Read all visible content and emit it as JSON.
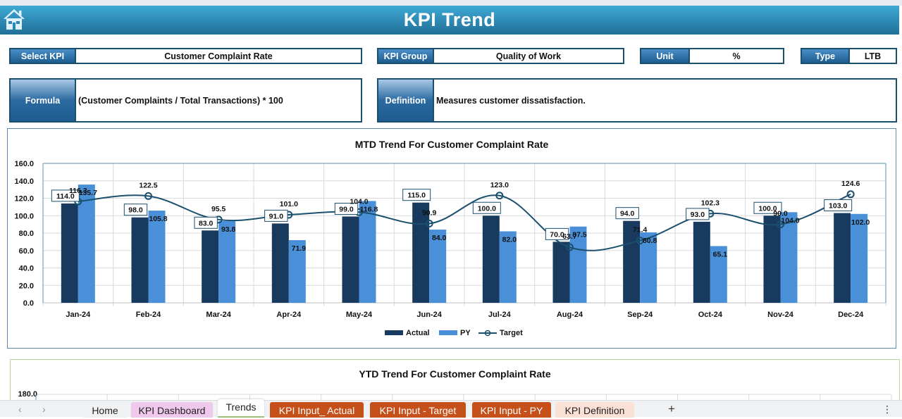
{
  "header": {
    "title": "KPI Trend",
    "home_icon": "home-icon"
  },
  "fields": {
    "select_kpi": {
      "label": "Select KPI",
      "value": "Customer Complaint Rate"
    },
    "kpi_group": {
      "label": "KPI Group",
      "value": "Quality of Work"
    },
    "unit": {
      "label": "Unit",
      "value": "%"
    },
    "type": {
      "label": "Type",
      "value": "LTB"
    },
    "formula": {
      "label": "Formula",
      "value": "(Customer Complaints / Total Transactions) * 100"
    },
    "definition": {
      "label": "Definition",
      "value": "Measures customer dissatisfaction."
    }
  },
  "chart_data": [
    {
      "type": "bar",
      "title": "MTD Trend For Customer Complaint Rate",
      "xlabel": "",
      "ylabel": "",
      "ylim": [
        0,
        160
      ],
      "yticks": [
        "0.0",
        "20.0",
        "40.0",
        "60.0",
        "80.0",
        "100.0",
        "120.0",
        "140.0",
        "160.0"
      ],
      "grid": true,
      "legend": "bottom",
      "categories": [
        "Jan-24",
        "Feb-24",
        "Mar-24",
        "Apr-24",
        "May-24",
        "Jun-24",
        "Jul-24",
        "Aug-24",
        "Sep-24",
        "Oct-24",
        "Nov-24",
        "Dec-24"
      ],
      "series": [
        {
          "name": "Actual",
          "kind": "bar",
          "color": "#173a5e",
          "values": [
            114.0,
            98.0,
            83.0,
            91.0,
            99.0,
            115.0,
            100.0,
            70.0,
            94.0,
            93.0,
            100.0,
            103.0
          ]
        },
        {
          "name": "PY",
          "kind": "bar",
          "color": "#4a90d9",
          "values": [
            135.7,
            105.8,
            93.8,
            71.9,
            116.8,
            84.0,
            82.0,
            87.5,
            80.8,
            65.1,
            104.0,
            102.0
          ]
        },
        {
          "name": "Target",
          "kind": "line",
          "color": "#1b4f6e",
          "values": [
            116.3,
            122.5,
            95.5,
            101.0,
            104.0,
            90.9,
            123.0,
            63.7,
            71.4,
            102.3,
            90.0,
            124.6
          ]
        }
      ]
    },
    {
      "type": "bar",
      "title": "YTD Trend For Customer Complaint Rate",
      "yticks_visible": [
        "180.0"
      ],
      "ylim": [
        0,
        180
      ]
    }
  ],
  "sheet_tabs": [
    {
      "label": "Home",
      "bg": "#f0f1f3",
      "fg": "#222222"
    },
    {
      "label": "KPI Dashboard",
      "bg": "#efc8ec",
      "fg": "#222222"
    },
    {
      "label": "Trends",
      "bg": "#ffffff",
      "fg": "#222222",
      "active": true
    },
    {
      "label": "KPI Input_ Actual",
      "bg": "#c5501a",
      "fg": "#ffffff"
    },
    {
      "label": "KPI Input - Target",
      "bg": "#c5501a",
      "fg": "#ffffff"
    },
    {
      "label": "KPI Input - PY",
      "bg": "#c5501a",
      "fg": "#ffffff"
    },
    {
      "label": "KPI Definition",
      "bg": "#fbe1d5",
      "fg": "#222222"
    }
  ],
  "tabbar": {
    "prev": "‹",
    "next": "›",
    "add": "+",
    "more": "⋮"
  }
}
